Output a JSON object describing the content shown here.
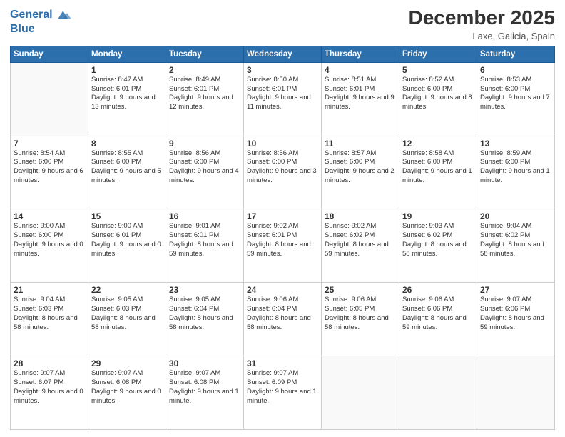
{
  "header": {
    "logo_line1": "General",
    "logo_line2": "Blue",
    "month": "December 2025",
    "location": "Laxe, Galicia, Spain"
  },
  "weekdays": [
    "Sunday",
    "Monday",
    "Tuesday",
    "Wednesday",
    "Thursday",
    "Friday",
    "Saturday"
  ],
  "weeks": [
    [
      {
        "day": "",
        "sunrise": "",
        "sunset": "",
        "daylight": ""
      },
      {
        "day": "1",
        "sunrise": "8:47 AM",
        "sunset": "6:01 PM",
        "daylight": "9 hours and 13 minutes."
      },
      {
        "day": "2",
        "sunrise": "8:49 AM",
        "sunset": "6:01 PM",
        "daylight": "9 hours and 12 minutes."
      },
      {
        "day": "3",
        "sunrise": "8:50 AM",
        "sunset": "6:01 PM",
        "daylight": "9 hours and 11 minutes."
      },
      {
        "day": "4",
        "sunrise": "8:51 AM",
        "sunset": "6:01 PM",
        "daylight": "9 hours and 9 minutes."
      },
      {
        "day": "5",
        "sunrise": "8:52 AM",
        "sunset": "6:00 PM",
        "daylight": "9 hours and 8 minutes."
      },
      {
        "day": "6",
        "sunrise": "8:53 AM",
        "sunset": "6:00 PM",
        "daylight": "9 hours and 7 minutes."
      }
    ],
    [
      {
        "day": "7",
        "sunrise": "8:54 AM",
        "sunset": "6:00 PM",
        "daylight": "9 hours and 6 minutes."
      },
      {
        "day": "8",
        "sunrise": "8:55 AM",
        "sunset": "6:00 PM",
        "daylight": "9 hours and 5 minutes."
      },
      {
        "day": "9",
        "sunrise": "8:56 AM",
        "sunset": "6:00 PM",
        "daylight": "9 hours and 4 minutes."
      },
      {
        "day": "10",
        "sunrise": "8:56 AM",
        "sunset": "6:00 PM",
        "daylight": "9 hours and 3 minutes."
      },
      {
        "day": "11",
        "sunrise": "8:57 AM",
        "sunset": "6:00 PM",
        "daylight": "9 hours and 2 minutes."
      },
      {
        "day": "12",
        "sunrise": "8:58 AM",
        "sunset": "6:00 PM",
        "daylight": "9 hours and 1 minute."
      },
      {
        "day": "13",
        "sunrise": "8:59 AM",
        "sunset": "6:00 PM",
        "daylight": "9 hours and 1 minute."
      }
    ],
    [
      {
        "day": "14",
        "sunrise": "9:00 AM",
        "sunset": "6:00 PM",
        "daylight": "9 hours and 0 minutes."
      },
      {
        "day": "15",
        "sunrise": "9:00 AM",
        "sunset": "6:01 PM",
        "daylight": "9 hours and 0 minutes."
      },
      {
        "day": "16",
        "sunrise": "9:01 AM",
        "sunset": "6:01 PM",
        "daylight": "8 hours and 59 minutes."
      },
      {
        "day": "17",
        "sunrise": "9:02 AM",
        "sunset": "6:01 PM",
        "daylight": "8 hours and 59 minutes."
      },
      {
        "day": "18",
        "sunrise": "9:02 AM",
        "sunset": "6:02 PM",
        "daylight": "8 hours and 59 minutes."
      },
      {
        "day": "19",
        "sunrise": "9:03 AM",
        "sunset": "6:02 PM",
        "daylight": "8 hours and 58 minutes."
      },
      {
        "day": "20",
        "sunrise": "9:04 AM",
        "sunset": "6:02 PM",
        "daylight": "8 hours and 58 minutes."
      }
    ],
    [
      {
        "day": "21",
        "sunrise": "9:04 AM",
        "sunset": "6:03 PM",
        "daylight": "8 hours and 58 minutes."
      },
      {
        "day": "22",
        "sunrise": "9:05 AM",
        "sunset": "6:03 PM",
        "daylight": "8 hours and 58 minutes."
      },
      {
        "day": "23",
        "sunrise": "9:05 AM",
        "sunset": "6:04 PM",
        "daylight": "8 hours and 58 minutes."
      },
      {
        "day": "24",
        "sunrise": "9:06 AM",
        "sunset": "6:04 PM",
        "daylight": "8 hours and 58 minutes."
      },
      {
        "day": "25",
        "sunrise": "9:06 AM",
        "sunset": "6:05 PM",
        "daylight": "8 hours and 58 minutes."
      },
      {
        "day": "26",
        "sunrise": "9:06 AM",
        "sunset": "6:06 PM",
        "daylight": "8 hours and 59 minutes."
      },
      {
        "day": "27",
        "sunrise": "9:07 AM",
        "sunset": "6:06 PM",
        "daylight": "8 hours and 59 minutes."
      }
    ],
    [
      {
        "day": "28",
        "sunrise": "9:07 AM",
        "sunset": "6:07 PM",
        "daylight": "9 hours and 0 minutes."
      },
      {
        "day": "29",
        "sunrise": "9:07 AM",
        "sunset": "6:08 PM",
        "daylight": "9 hours and 0 minutes."
      },
      {
        "day": "30",
        "sunrise": "9:07 AM",
        "sunset": "6:08 PM",
        "daylight": "9 hours and 1 minute."
      },
      {
        "day": "31",
        "sunrise": "9:07 AM",
        "sunset": "6:09 PM",
        "daylight": "9 hours and 1 minute."
      },
      {
        "day": "",
        "sunrise": "",
        "sunset": "",
        "daylight": ""
      },
      {
        "day": "",
        "sunrise": "",
        "sunset": "",
        "daylight": ""
      },
      {
        "day": "",
        "sunrise": "",
        "sunset": "",
        "daylight": ""
      }
    ]
  ]
}
